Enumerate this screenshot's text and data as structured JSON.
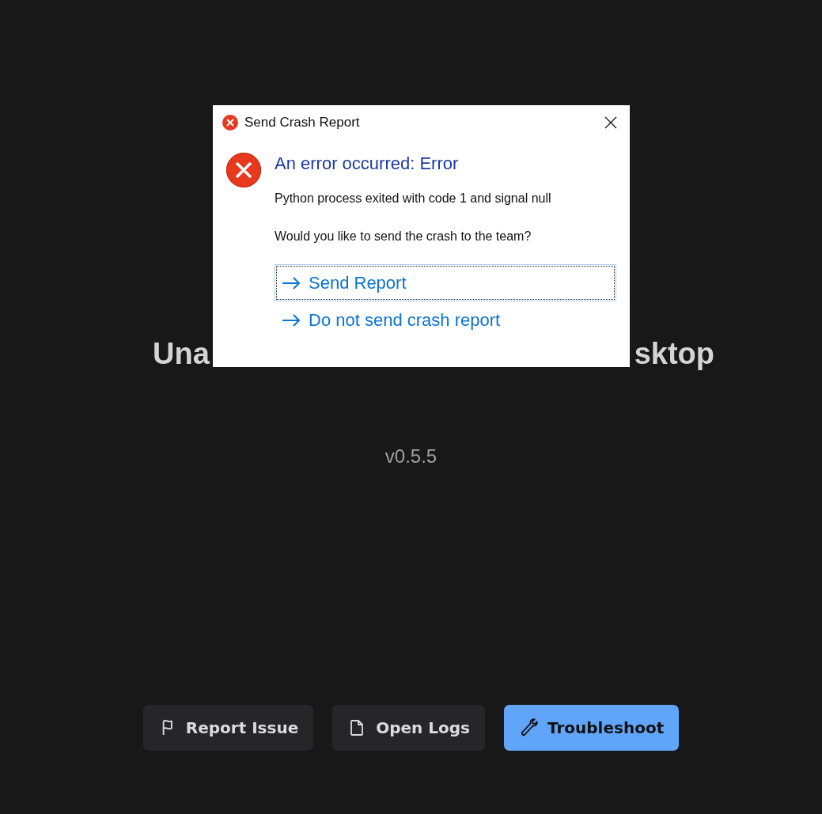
{
  "background": {
    "heading_parts": [
      "Una",
      "sktop"
    ],
    "version": "v0.5.5",
    "buttons": [
      {
        "label": "Report Issue",
        "kind": "secondary"
      },
      {
        "label": "Open Logs",
        "kind": "secondary"
      },
      {
        "label": "Troubleshoot",
        "kind": "primary"
      }
    ]
  },
  "dialog": {
    "title": "Send Crash Report",
    "heading": "An error occurred: Error",
    "message": "Python process exited with code 1 and signal null",
    "question": "Would you like to send the crash to the team?",
    "options": [
      {
        "label": "Send Report",
        "selected": true
      },
      {
        "label": "Do not send crash report",
        "selected": false
      }
    ]
  }
}
